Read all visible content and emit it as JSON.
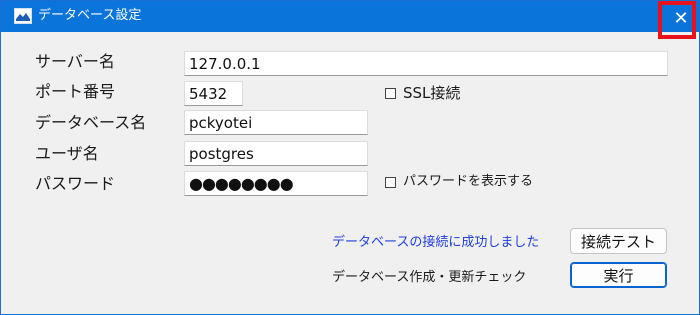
{
  "window": {
    "title": "データベース設定",
    "close_glyph": "✕",
    "app_icon": "database-app-icon"
  },
  "form": {
    "server": {
      "label": "サーバー名",
      "value": "127.0.0.1"
    },
    "port": {
      "label": "ポート番号",
      "value": "5432"
    },
    "ssl": {
      "label": "SSL接続",
      "checked": false
    },
    "database": {
      "label": "データベース名",
      "value": "pckyotei"
    },
    "user": {
      "label": "ユーザ名",
      "value": "postgres"
    },
    "password": {
      "label": "パスワード",
      "masked": "●●●●●●●●"
    },
    "show_password": {
      "label": "パスワードを表示する",
      "checked": false
    }
  },
  "status": {
    "message": "データベースの接続に成功しました",
    "message_color": "#1f3fd8"
  },
  "buttons": {
    "test_connection": "接続テスト",
    "execute": "実行"
  },
  "note": "データベース作成・更新チェック",
  "colors": {
    "titlebar": "#0a74da",
    "highlight": "#e8131a"
  }
}
